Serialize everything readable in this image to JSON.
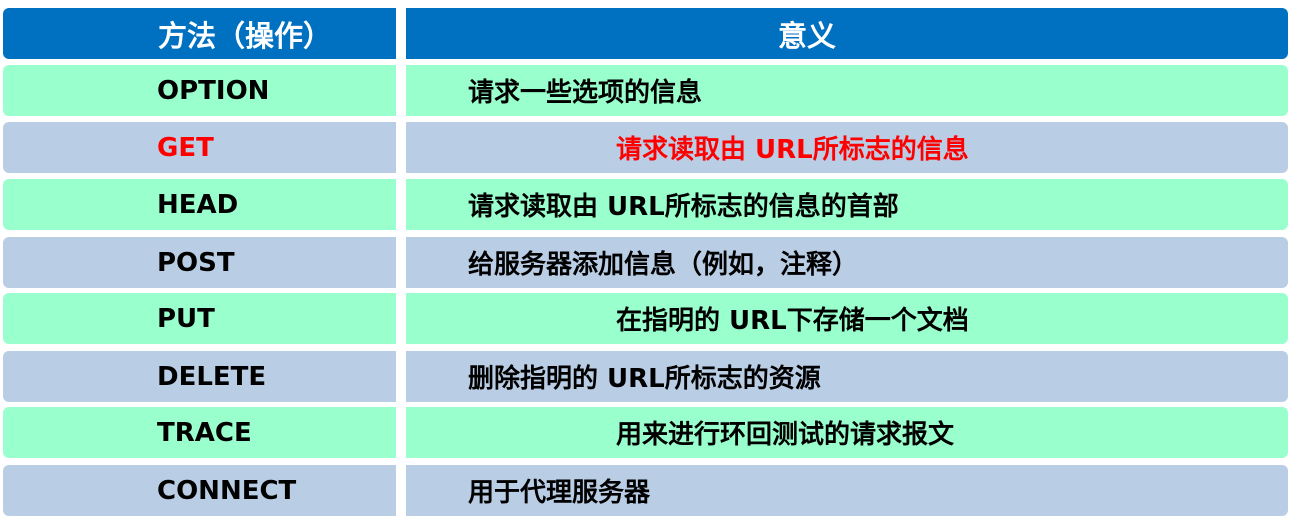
{
  "header": {
    "method_label": "方法（操作）",
    "meaning_label": "意义"
  },
  "colors": {
    "header_bg": "#0070c0",
    "row_green": "#99ffcc",
    "row_blue": "#b9cde5",
    "highlight": "#ff0000"
  },
  "rows": [
    {
      "method": "OPTION",
      "meaning": "请求一些选项的信息"
    },
    {
      "method": "GET",
      "meaning": "请求读取由 URL所标志的信息",
      "highlighted": true
    },
    {
      "method": "HEAD",
      "meaning": "请求读取由 URL所标志的信息的首部"
    },
    {
      "method": "POST",
      "meaning": "给服务器添加信息（例如，注释）"
    },
    {
      "method": "PUT",
      "meaning": "在指明的 URL下存储一个文档"
    },
    {
      "method": "DELETE",
      "meaning": "删除指明的 URL所标志的资源"
    },
    {
      "method": "TRACE",
      "meaning": "用来进行环回测试的请求报文"
    },
    {
      "method": "CONNECT",
      "meaning": "用于代理服务器"
    }
  ]
}
